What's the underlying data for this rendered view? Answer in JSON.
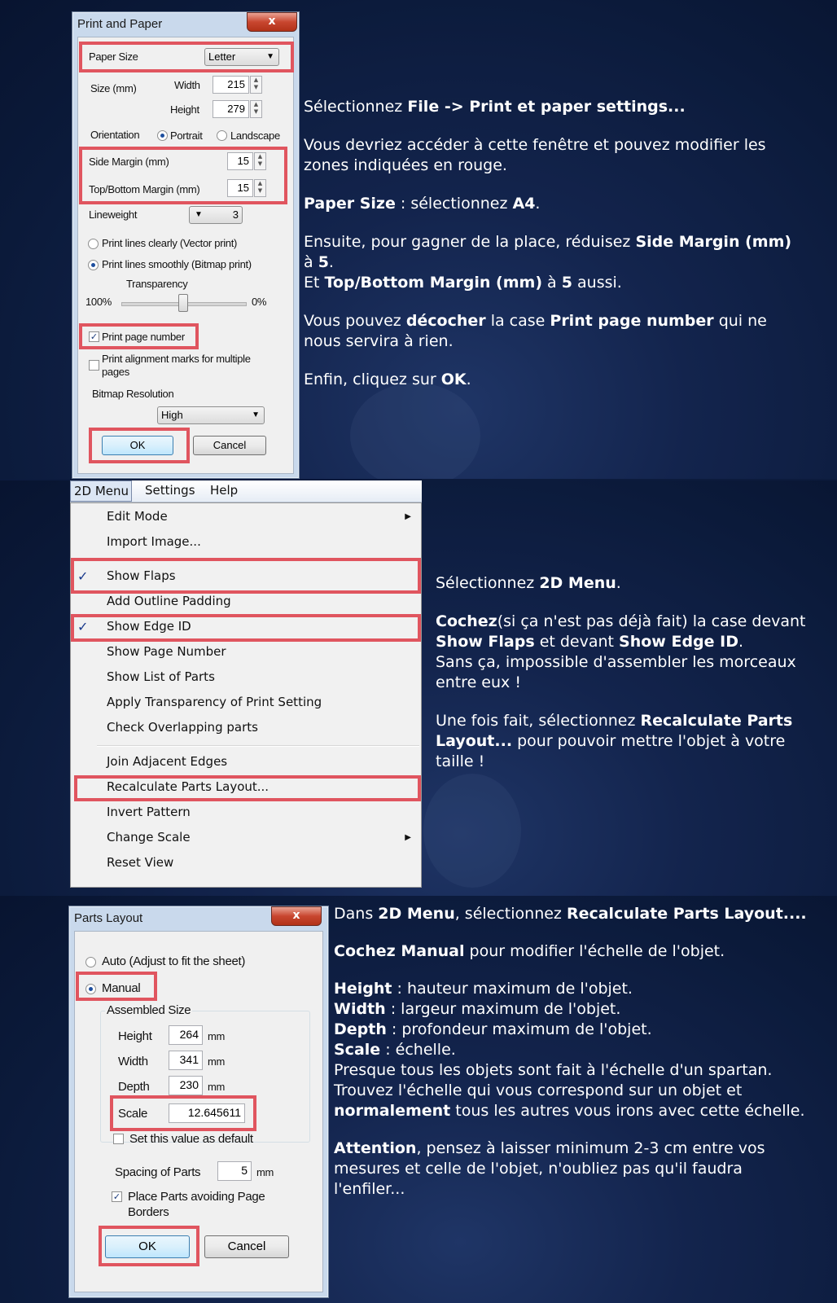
{
  "section1": {
    "dialog": {
      "title": "Print and Paper",
      "close": "x",
      "paper_size_label": "Paper Size",
      "paper_size_value": "Letter",
      "size_label": "Size (mm)",
      "width_label": "Width",
      "width_value": "215",
      "height_label": "Height",
      "height_value": "279",
      "orientation_label": "Orientation",
      "portrait": "Portrait",
      "landscape": "Landscape",
      "side_margin_label": "Side Margin (mm)",
      "side_margin_value": "15",
      "tb_margin_label": "Top/Bottom Margin (mm)",
      "tb_margin_value": "15",
      "lineweight_label": "Lineweight",
      "lineweight_value": "3",
      "vector_print": "Print lines clearly (Vector print)",
      "bitmap_print": "Print lines smoothly (Bitmap print)",
      "transparency_label": "Transparency",
      "transparency_min": "100%",
      "transparency_max": "0%",
      "print_page_number": "Print page number",
      "print_alignment_1": "Print alignment marks for multiple",
      "print_alignment_2": "pages",
      "bitmap_resolution_label": "Bitmap Resolution",
      "bitmap_resolution_value": "High",
      "ok": "OK",
      "cancel": "Cancel"
    },
    "text": {
      "l1a": "Sélectionnez ",
      "l1b": "File -> Print et paper settings...",
      "l2": "Vous devriez accéder à cette fenêtre et pouvez modifier les zones indiquées en rouge.",
      "l3a": "Paper Size",
      "l3b": " : sélectionnez ",
      "l3c": "A4",
      "l3d": ".",
      "l4a": "Ensuite, pour gagner de la place, réduisez ",
      "l4b": "Side Margin (mm)",
      "l4c": " à ",
      "l4d": "5",
      "l4e": ".",
      "l5a": "Et ",
      "l5b": "Top/Bottom Margin (mm)",
      "l5c": " à ",
      "l5d": "5",
      "l5e": " aussi.",
      "l6a": "Vous pouvez ",
      "l6b": "décocher",
      "l6c": " la case ",
      "l6d": "Print page number",
      "l6e": " qui ne nous servira à rien.",
      "l7a": "Enfin, cliquez sur ",
      "l7b": "OK",
      "l7c": "."
    }
  },
  "section2": {
    "menubar": {
      "menu1": "2D Menu",
      "menu2": "Settings",
      "menu3": "Help"
    },
    "menu": {
      "edit_mode": "Edit Mode",
      "import_image": "Import Image...",
      "show_flaps": "Show Flaps",
      "add_outline_padding": "Add Outline Padding",
      "show_edge_id": "Show Edge ID",
      "show_page_number": "Show Page Number",
      "show_list_of_parts": "Show List of Parts",
      "apply_transparency": "Apply Transparency of Print Setting",
      "check_overlapping": "Check Overlapping parts",
      "join_adjacent": "Join Adjacent Edges",
      "recalculate": "Recalculate Parts Layout...",
      "invert_pattern": "Invert Pattern",
      "change_scale": "Change Scale",
      "reset_view": "Reset View",
      "checkmark": "✓"
    },
    "text": {
      "l1a": "Sélectionnez ",
      "l1b": "2D Menu",
      "l1c": ".",
      "l2a": "Cochez",
      "l2b": "(si ça n'est pas déjà fait) la case devant ",
      "l2c": "Show Flaps",
      "l2d": " et devant ",
      "l2e": "Show Edge ID",
      "l2f": ".",
      "l3": "Sans ça, impossible d'assembler les morceaux entre eux !",
      "l4a": "Une fois fait, sélectionnez ",
      "l4b": "Recalculate Parts Layout...",
      "l4c": " pour pouvoir mettre l'objet à votre taille !"
    }
  },
  "section3": {
    "dialog": {
      "title": "Parts Layout",
      "close": "x",
      "auto": "Auto (Adjust to fit the sheet)",
      "manual": "Manual",
      "assembled_size": "Assembled Size",
      "height_label": "Height",
      "height_value": "264",
      "width_label": "Width",
      "width_value": "341",
      "depth_label": "Depth",
      "depth_value": "230",
      "unit": "mm",
      "scale_label": "Scale",
      "scale_value": "12.645611",
      "set_default": "Set this value as default",
      "spacing_label": "Spacing of Parts",
      "spacing_value": "5",
      "avoid_borders_1": "Place Parts avoiding Page",
      "avoid_borders_2": "Borders",
      "ok": "OK",
      "cancel": "Cancel"
    },
    "text": {
      "l1a": "Dans ",
      "l1b": "2D Menu",
      "l1c": ", sélectionnez ",
      "l1d": "Recalculate Parts Layout....",
      "l2a": "Cochez Manual",
      "l2b": " pour modifier l'échelle de l'objet.",
      "h_b": "Height",
      "h_t": " : hauteur maximum de l'objet.",
      "w_b": "Width",
      "w_t": " : largeur maximum de l'objet.",
      "d_b": "Depth",
      "d_t": " : profondeur maximum de l'objet.",
      "s_b": "Scale",
      "s_t": " : échelle.",
      "p1": "Presque tous les objets sont fait à l'échelle d'un spartan. Trouvez l'échelle qui vous correspond sur un objet et ",
      "p1b": "normalement",
      "p1c": " tous les autres vous irons avec cette échelle.",
      "a1": "Attention",
      "a2": ", pensez à laisser minimum 2-3 cm entre vos mesures et celle de l'objet, n'oubliez pas qu'il faudra l'enfiler..."
    }
  }
}
